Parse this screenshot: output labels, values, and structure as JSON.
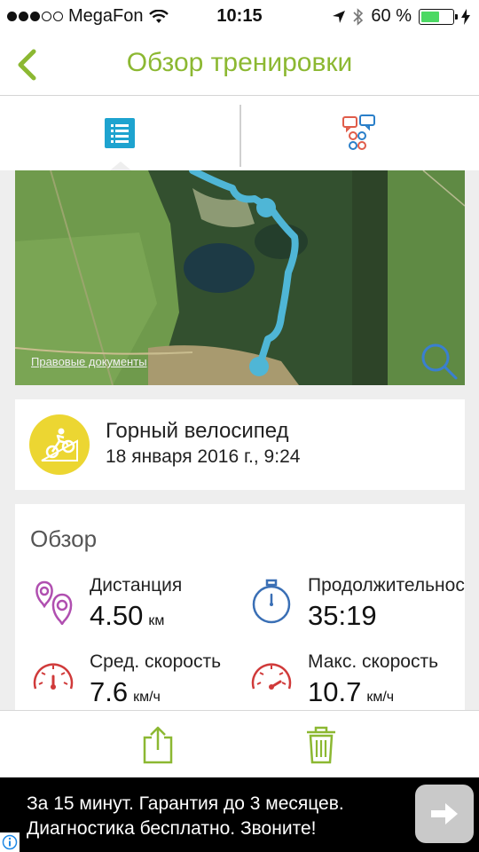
{
  "status_bar": {
    "carrier": "MegaFon",
    "time": "10:15",
    "battery_percent": "60 %",
    "battery_level": 0.6,
    "signal_bars_filled": 3,
    "signal_bars_total": 5
  },
  "nav": {
    "title": "Обзор тренировки",
    "accent_color": "#8cb832"
  },
  "map": {
    "legal_link": "Правовые документы",
    "route_color": "#4fb6d6"
  },
  "activity": {
    "name": "Горный велосипед",
    "date": "18 января 2016 г., 9:24",
    "icon": "mountain-bike-icon",
    "icon_color": "#ecd632"
  },
  "overview": {
    "title": "Обзор",
    "stats": [
      {
        "label": "Дистанция",
        "value": "4.50",
        "unit": "км",
        "icon": "distance-pins-icon"
      },
      {
        "label": "Продолжительность",
        "value": "35:19",
        "unit": "",
        "icon": "stopwatch-icon"
      },
      {
        "label": "Сред. скорость",
        "value": "7.6",
        "unit": "км/ч",
        "icon": "avg-speed-gauge-icon"
      },
      {
        "label": "Макс. скорость",
        "value": "10.7",
        "unit": "км/ч",
        "icon": "max-speed-gauge-icon"
      }
    ]
  },
  "ad": {
    "line1": "За 15 минут. Гарантия до 3 месяцев.",
    "line2": "Диагностика бесплатно. Звоните!"
  }
}
